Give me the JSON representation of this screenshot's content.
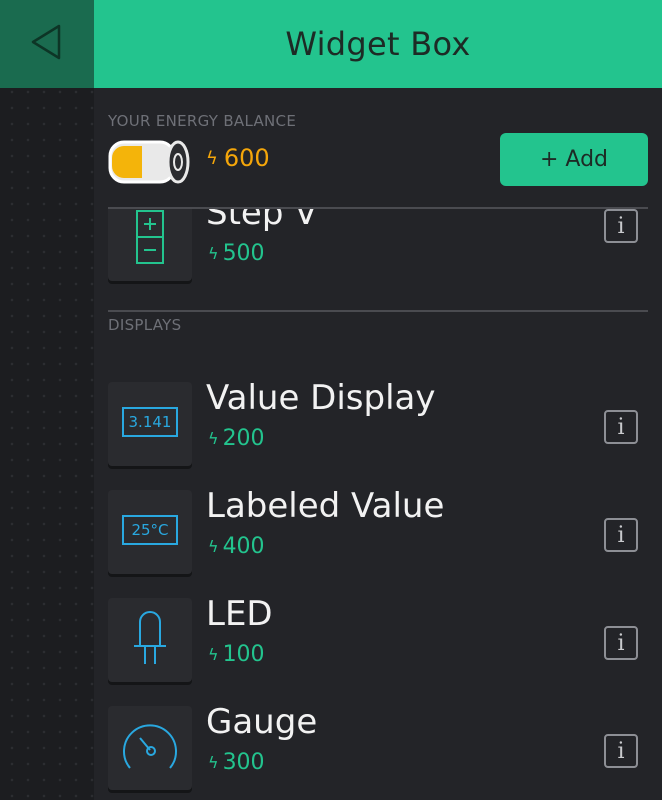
{
  "header": {
    "title": "Widget Box",
    "back_icon": "back-arrow-icon"
  },
  "energy": {
    "label": "YOUR ENERGY BALANCE",
    "value": "600",
    "add_label": "+ Add",
    "accent": "#f4a60a"
  },
  "sections": [
    {
      "label": "DISPLAYS"
    }
  ],
  "items": [
    {
      "title": "Step V",
      "cost": "500",
      "icon": "step-icon"
    },
    {
      "title": "Value Display",
      "cost": "200",
      "icon": "value-display-icon",
      "icon_text": "3.141"
    },
    {
      "title": "Labeled Value",
      "cost": "400",
      "icon": "labeled-value-icon",
      "icon_text": "25°C"
    },
    {
      "title": "LED",
      "cost": "100",
      "icon": "led-icon"
    },
    {
      "title": "Gauge",
      "cost": "300",
      "icon": "gauge-icon"
    }
  ],
  "colors": {
    "brand": "#23c48e",
    "background": "#232428",
    "icon_blue": "#29a8e0"
  }
}
